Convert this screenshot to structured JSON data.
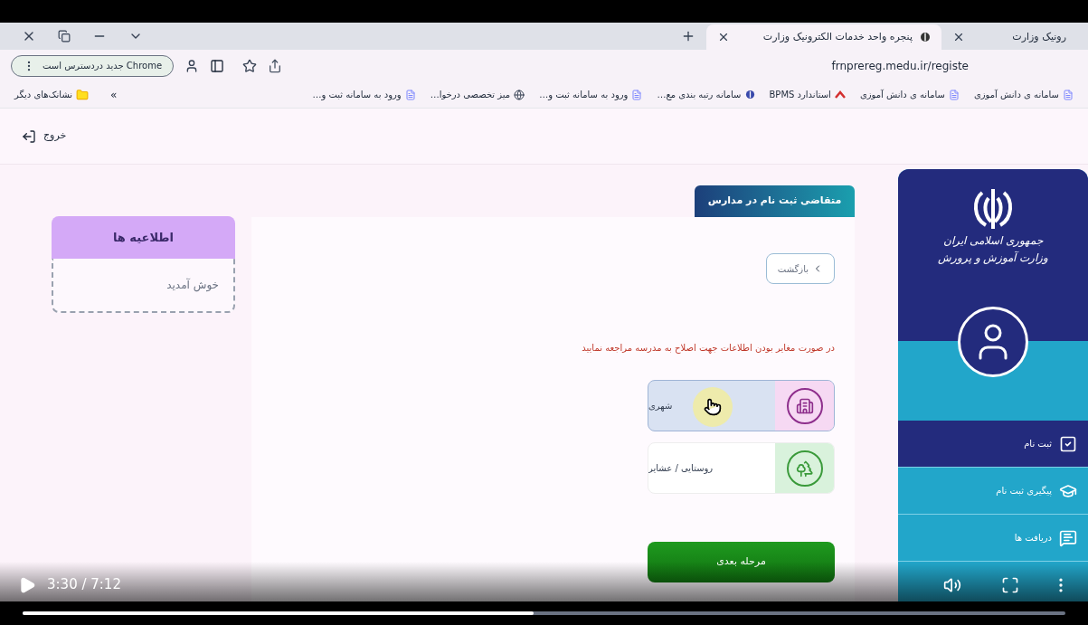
{
  "browser": {
    "tabs": [
      {
        "title": "رونیک وزارت",
        "selected": false
      },
      {
        "title": "پنجره واحد خدمات الکترونیک وزارت",
        "selected": true
      }
    ],
    "address": "frnprereg.medu.ir/registe",
    "update_chip": "Chrome جدید دردسترس است",
    "bookmarks": [
      "سامانه ی دانش آموزی",
      "سامانه ی دانش آموزی",
      "استاندارد BPMS",
      "سامانه رتبه بندی مع…",
      "ورود به سامانه ثبت و…",
      "میز تخصصی درخوا…",
      "ورود به سامانه ثبت و…"
    ],
    "overflow": "«",
    "other_bookmarks": "نشانک‌های دیگر"
  },
  "page": {
    "logout": "خروج",
    "notices": {
      "title": "اطلاعیه ها",
      "body": "خوش آمدید"
    },
    "form": {
      "tab": "متقاضی ثبت نام در مدارس",
      "back": "بازگشت",
      "warning": "در صورت مغایر بودن اطلاعات جهت اصلاح به مدرسه مراجعه نمایید",
      "options": [
        {
          "label": "شهری",
          "kind": "urban",
          "selected": true
        },
        {
          "label": "روستایی / عشایر",
          "kind": "rural",
          "selected": false
        }
      ],
      "next": "مرحله بعدی"
    },
    "sidebar": {
      "title_lines": [
        "جمهوری اسلامی ایران",
        "وزارت آموزش و پرورش"
      ],
      "items": [
        {
          "label": "ثبت نام",
          "kind": "register",
          "selected": true
        },
        {
          "label": "پیگیری ثبت نام",
          "kind": "track",
          "selected": false
        },
        {
          "label": "دریافت ها",
          "kind": "messages",
          "selected": false
        }
      ]
    }
  },
  "player": {
    "time": "3:30 / 7:12",
    "level": 0.49
  }
}
